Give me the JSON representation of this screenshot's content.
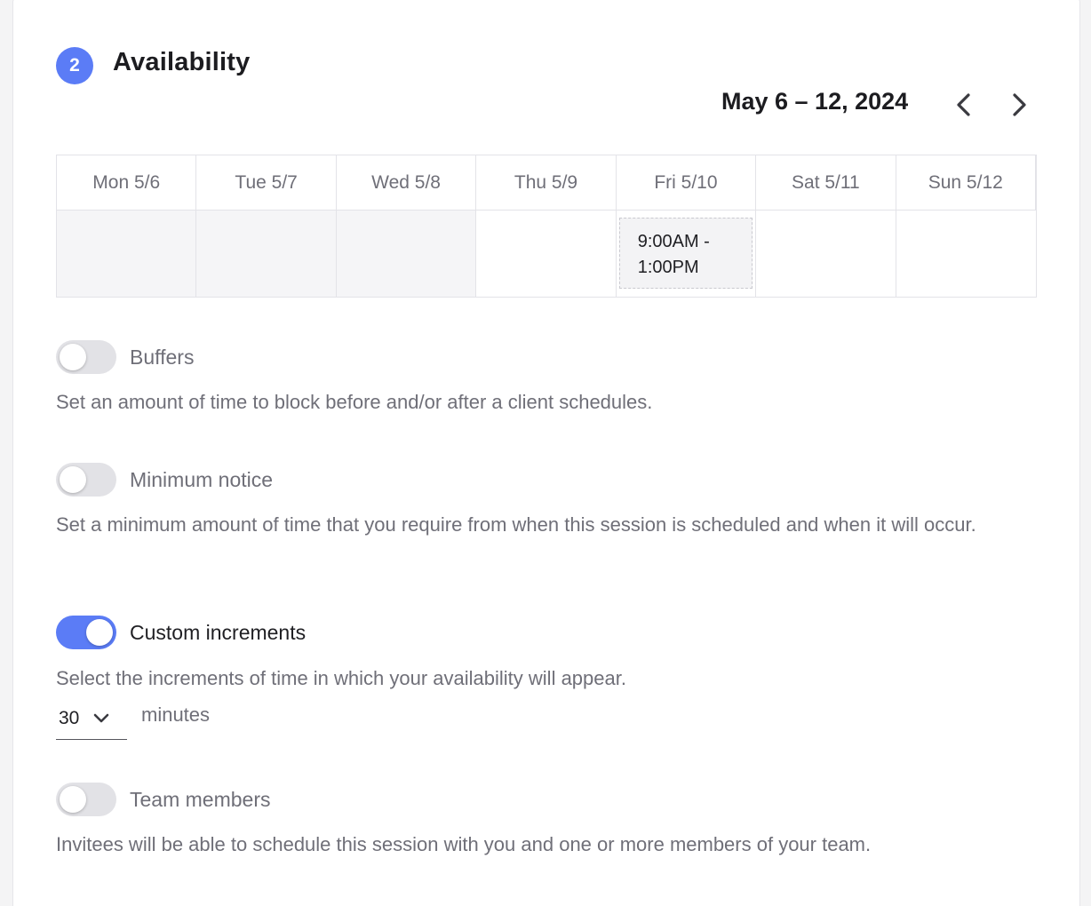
{
  "section": {
    "step_number": "2",
    "title": "Availability"
  },
  "week": {
    "range_label": "May 6 – 12, 2024",
    "prev_icon": "chevron-left-icon",
    "next_icon": "chevron-right-icon"
  },
  "calendar": {
    "days": [
      "Mon 5/6",
      "Tue 5/7",
      "Wed 5/8",
      "Thu 5/9",
      "Fri 5/10",
      "Sat 5/11",
      "Sun 5/12"
    ],
    "past_days": [
      0,
      1,
      2
    ],
    "slots": [
      {
        "day_index": 4,
        "line1": "9:00AM -",
        "line2": "1:00PM"
      }
    ]
  },
  "options": {
    "buffers": {
      "label": "Buffers",
      "enabled": false,
      "description": "Set an amount of time to block before and/or after a client schedules."
    },
    "minimum_notice": {
      "label": "Minimum notice",
      "enabled": false,
      "description": "Set a minimum amount of time that you require from when this session is scheduled and when it will occur."
    },
    "custom_increments": {
      "label": "Custom increments",
      "enabled": true,
      "description": "Select the increments of time in which your availability will appear.",
      "selected_value": "30",
      "unit": "minutes"
    },
    "team_members": {
      "label": "Team members",
      "enabled": false,
      "description": "Invitees will be able to schedule this session with you and one or more members of your team."
    }
  },
  "colors": {
    "accent": "#5b7cf6",
    "toggle_off": "#e2e2e6",
    "muted_text": "#6f6f78",
    "past_day_bg": "#f5f5f7"
  }
}
